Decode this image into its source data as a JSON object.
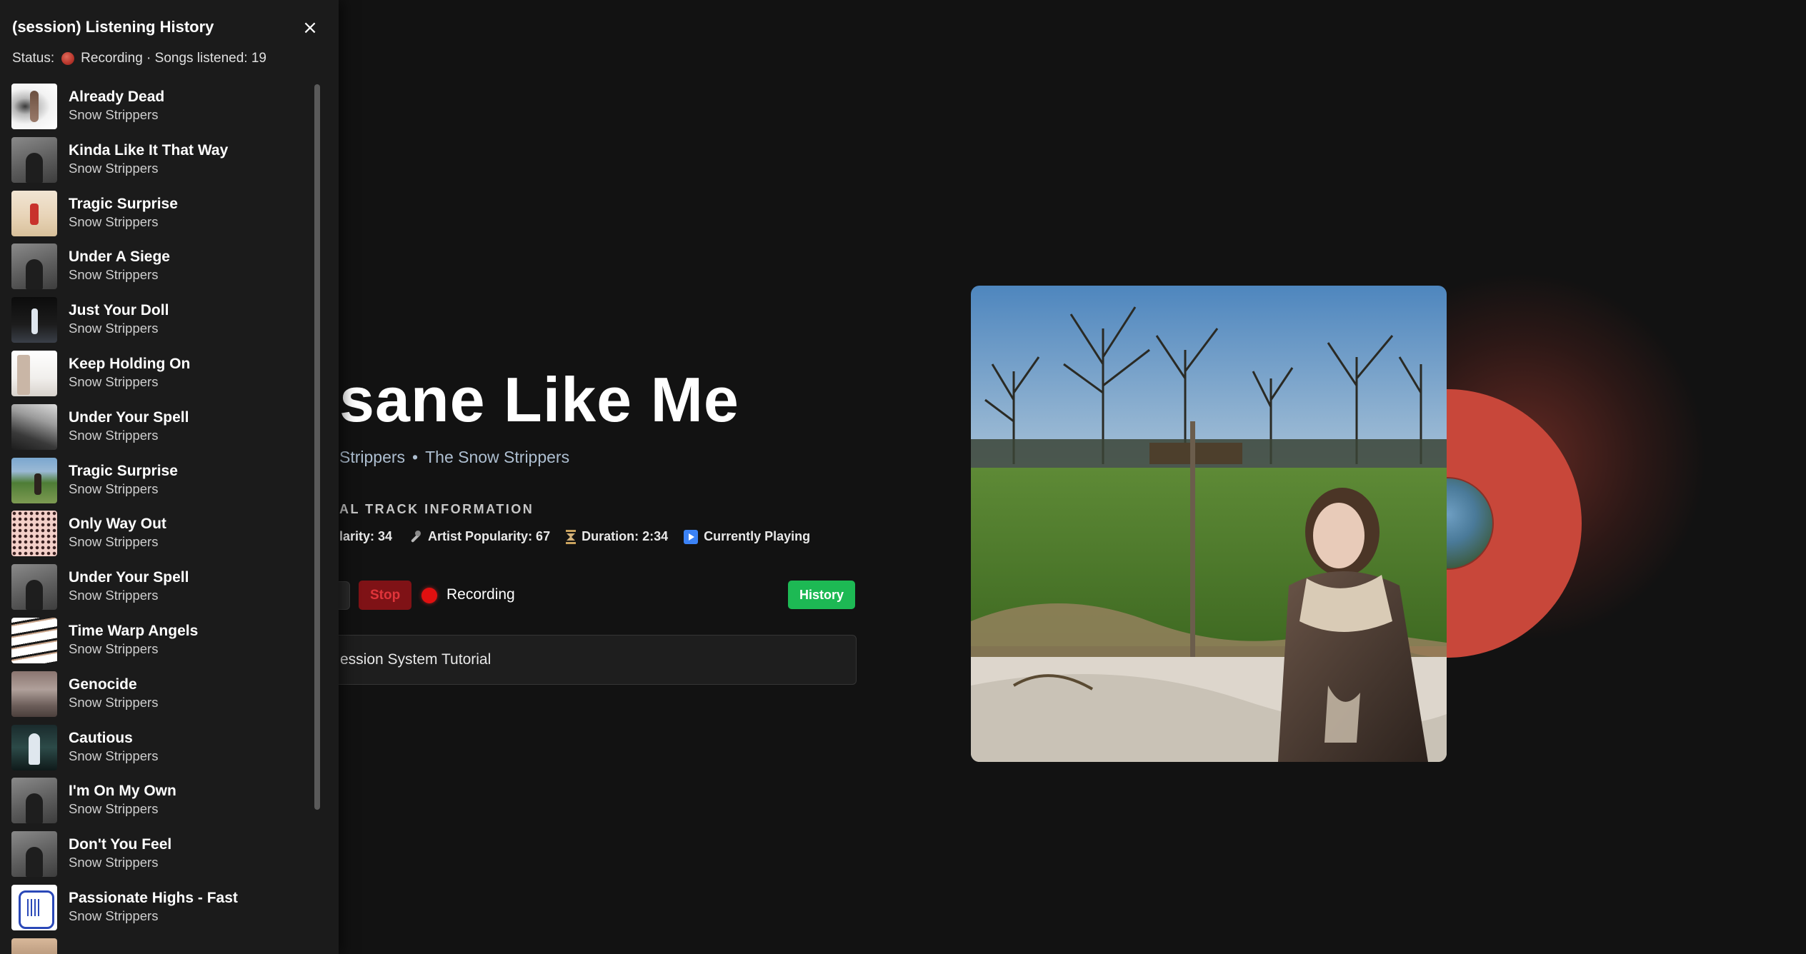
{
  "track": {
    "title": "sane Like Me",
    "artists": [
      "Strippers",
      "The Snow Strippers"
    ],
    "section_label": "AL TRACK INFORMATION",
    "stats": {
      "popularity": "larity: 34",
      "artist_popularity": "Artist Popularity: 67",
      "duration": "Duration: 2:34",
      "status": "Currently Playing"
    }
  },
  "controls": {
    "stop_label": "Stop",
    "recording_label": "Recording",
    "history_label": "History"
  },
  "tutorial": {
    "label": "ession System Tutorial"
  },
  "colors": {
    "background": "#121212",
    "panel": "#1b1b1b",
    "accent_green": "#1db954",
    "stop_red": "#7f1216",
    "recording_red": "#e01010",
    "vinyl": "#c8473a"
  },
  "panel": {
    "title": "(session) Listening History",
    "close_icon": "×",
    "status_prefix": "Status:",
    "status_suffix": "Recording · Songs listened: 19"
  },
  "history": [
    {
      "title": "Already Dead",
      "artist": "Snow Strippers",
      "art": "t-dead"
    },
    {
      "title": "Kinda Like It That Way",
      "artist": "Snow Strippers",
      "art": "t-gray"
    },
    {
      "title": "Tragic Surprise",
      "artist": "Snow Strippers",
      "art": "t-beach"
    },
    {
      "title": "Under A Siege",
      "artist": "Snow Strippers",
      "art": "t-gray"
    },
    {
      "title": "Just Your Doll",
      "artist": "Snow Strippers",
      "art": "t-doll"
    },
    {
      "title": "Keep Holding On",
      "artist": "Snow Strippers",
      "art": "t-white"
    },
    {
      "title": "Under Your Spell",
      "artist": "Snow Strippers",
      "art": "t-spell"
    },
    {
      "title": "Tragic Surprise",
      "artist": "Snow Strippers",
      "art": "t-field"
    },
    {
      "title": "Only Way Out",
      "artist": "Snow Strippers",
      "art": "t-dots"
    },
    {
      "title": "Under Your Spell",
      "artist": "Snow Strippers",
      "art": "t-gray"
    },
    {
      "title": "Time Warp Angels",
      "artist": "Snow Strippers",
      "art": "t-stripes"
    },
    {
      "title": "Genocide",
      "artist": "Snow Strippers",
      "art": "t-genocide"
    },
    {
      "title": "Cautious",
      "artist": "Snow Strippers",
      "art": "t-cautious"
    },
    {
      "title": "I'm On My Own",
      "artist": "Snow Strippers",
      "art": "t-gray"
    },
    {
      "title": "Don't You Feel",
      "artist": "Snow Strippers",
      "art": "t-gray"
    },
    {
      "title": "Passionate Highs - Fast",
      "artist": "Snow Strippers",
      "art": "t-passion"
    },
    {
      "title": "",
      "artist": "",
      "art": "t-partial"
    }
  ]
}
